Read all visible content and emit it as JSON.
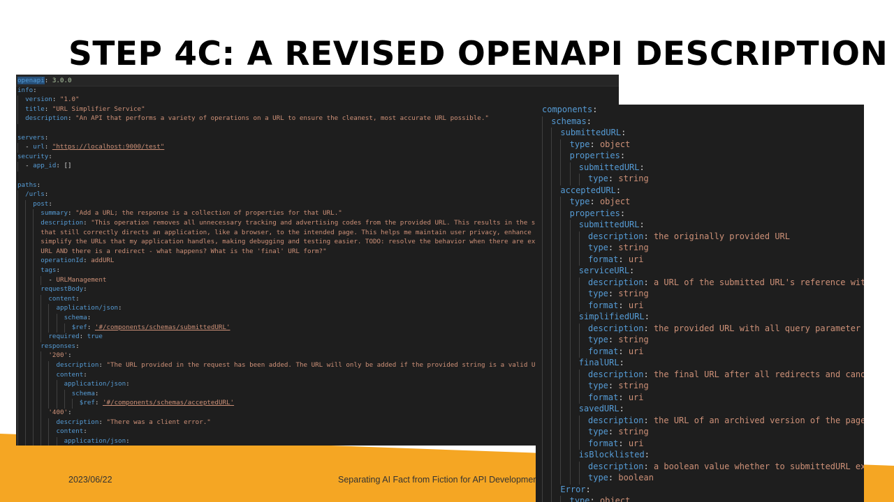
{
  "slide": {
    "title": "STEP 4C: A REVISED OPENAPI DESCRIPTION",
    "date": "2023/06/22",
    "subtitle": "Separating AI Fact from Fiction for API Development"
  },
  "colors": {
    "accent_orange": "#f5a623",
    "editor_background": "#1e1e1e",
    "key_blue": "#569cd6",
    "string_orange": "#ce9178",
    "value_green": "#b5cea8",
    "punctuation": "#d4d4d4"
  },
  "left_code": [
    {
      "indent": 0,
      "key": "openapi",
      "value": "3.0.0",
      "vtype": "c",
      "highlight_key": true
    },
    {
      "indent": 0,
      "key": "info"
    },
    {
      "indent": 2,
      "key": "version",
      "value": "\"1.0\"",
      "vtype": "s"
    },
    {
      "indent": 2,
      "key": "title",
      "value": "\"URL Simplifier Service\"",
      "vtype": "s"
    },
    {
      "indent": 2,
      "key": "description",
      "value": "\"An API that performs a variety of operations on a URL to ensure the cleanest, most accurate URL possible.\"",
      "vtype": "s"
    },
    {
      "indent": 0
    },
    {
      "indent": 0,
      "key": "servers"
    },
    {
      "indent": 2,
      "dash": true,
      "key": "url",
      "value": "\"https://localhost:9000/test\"",
      "vtype": "s",
      "underline": true
    },
    {
      "indent": 0,
      "key": "security"
    },
    {
      "indent": 2,
      "dash": true,
      "key": "app_id",
      "value": "[]",
      "vtype": "p"
    },
    {
      "indent": 0
    },
    {
      "indent": 0,
      "key": "paths"
    },
    {
      "indent": 2,
      "key": "/urls"
    },
    {
      "indent": 4,
      "key": "post"
    },
    {
      "indent": 6,
      "key": "summary",
      "value": "\"Add a URL; the response is a collection of properties for that URL.\"",
      "vtype": "s"
    },
    {
      "indent": 6,
      "key": "description",
      "value": "\"This operation removes all unnecessary tracking and advertising codes from the provided URL. This results in the simplest URL",
      "vtype": "s"
    },
    {
      "indent": 6,
      "text": "that still correctly directs an application, like a browser, to the intended page. This helps me maintain user privacy, enhance performance and",
      "vtype": "s"
    },
    {
      "indent": 6,
      "text": "simplify the URLs that my application handles, making debugging and testing easier. TODO: resolve the behavior when there are extra parameters in the",
      "vtype": "s"
    },
    {
      "indent": 6,
      "text": "URL AND there is a redirect - what happens? What is the 'final' URL form?\"",
      "vtype": "s"
    },
    {
      "indent": 6,
      "key": "operationId",
      "value": "addURL",
      "vtype": "s"
    },
    {
      "indent": 6,
      "key": "tags"
    },
    {
      "indent": 8,
      "dash": true,
      "text": "URLManagement",
      "vtype": "s"
    },
    {
      "indent": 6,
      "key": "requestBody"
    },
    {
      "indent": 8,
      "key": "content"
    },
    {
      "indent": 10,
      "key": "application/json"
    },
    {
      "indent": 12,
      "key": "schema"
    },
    {
      "indent": 14,
      "key": "$ref",
      "value": "'#/components/schemas/submittedURL'",
      "vtype": "s",
      "underline": true
    },
    {
      "indent": 8,
      "key": "required",
      "value": "true",
      "vtype": "k"
    },
    {
      "indent": 6,
      "key": "responses"
    },
    {
      "indent": 8,
      "key": "'200'",
      "keytype": "s"
    },
    {
      "indent": 10,
      "key": "description",
      "value": "\"The URL provided in the request has been added. The URL will only be added if the provided string is a valid URL.\"",
      "vtype": "s"
    },
    {
      "indent": 10,
      "key": "content"
    },
    {
      "indent": 12,
      "key": "application/json"
    },
    {
      "indent": 14,
      "key": "schema"
    },
    {
      "indent": 16,
      "key": "$ref",
      "value": "'#/components/schemas/acceptedURL'",
      "vtype": "s",
      "underline": true
    },
    {
      "indent": 8,
      "key": "'400'",
      "keytype": "s"
    },
    {
      "indent": 10,
      "key": "description",
      "value": "\"There was a client error.\"",
      "vtype": "s"
    },
    {
      "indent": 10,
      "key": "content"
    },
    {
      "indent": 12,
      "key": "application/json"
    }
  ],
  "right_code": [
    {
      "indent": 0,
      "key": "components"
    },
    {
      "indent": 2,
      "key": "schemas"
    },
    {
      "indent": 4,
      "key": "submittedURL"
    },
    {
      "indent": 6,
      "key": "type",
      "value": "object",
      "vtype": "s"
    },
    {
      "indent": 6,
      "key": "properties"
    },
    {
      "indent": 8,
      "key": "submittedURL"
    },
    {
      "indent": 10,
      "key": "type",
      "value": "string",
      "vtype": "s"
    },
    {
      "indent": 4,
      "key": "acceptedURL"
    },
    {
      "indent": 6,
      "key": "type",
      "value": "object",
      "vtype": "s"
    },
    {
      "indent": 6,
      "key": "properties"
    },
    {
      "indent": 8,
      "key": "submittedURL"
    },
    {
      "indent": 10,
      "key": "description",
      "value": "the originally provided URL",
      "vtype": "s"
    },
    {
      "indent": 10,
      "key": "type",
      "value": "string",
      "vtype": "s"
    },
    {
      "indent": 10,
      "key": "format",
      "value": "uri",
      "vtype": "s"
    },
    {
      "indent": 8,
      "key": "serviceURL"
    },
    {
      "indent": 10,
      "key": "description",
      "value": "a URL of the submitted URL's reference within the service",
      "vtype": "s"
    },
    {
      "indent": 10,
      "key": "type",
      "value": "string",
      "vtype": "s"
    },
    {
      "indent": 10,
      "key": "format",
      "value": "uri",
      "vtype": "s"
    },
    {
      "indent": 8,
      "key": "simplifiedURL"
    },
    {
      "indent": 10,
      "key": "description",
      "value": "the provided URL with all query parameter ad tracking removed",
      "vtype": "s"
    },
    {
      "indent": 10,
      "key": "type",
      "value": "string",
      "vtype": "s"
    },
    {
      "indent": 10,
      "key": "format",
      "value": "uri",
      "vtype": "s"
    },
    {
      "indent": 8,
      "key": "finalURL"
    },
    {
      "indent": 10,
      "key": "description",
      "value": "the final URL after all redirects and canonicalization",
      "vtype": "s"
    },
    {
      "indent": 10,
      "key": "type",
      "value": "string",
      "vtype": "s"
    },
    {
      "indent": 10,
      "key": "format",
      "value": "uri",
      "vtype": "s"
    },
    {
      "indent": 8,
      "key": "savedURL"
    },
    {
      "indent": 10,
      "key": "description",
      "value": "the URL of an archived version of the page; if available",
      "vtype": "s"
    },
    {
      "indent": 10,
      "key": "type",
      "value": "string",
      "vtype": "s"
    },
    {
      "indent": 10,
      "key": "format",
      "value": "uri",
      "vtype": "s"
    },
    {
      "indent": 8,
      "key": "isBlocklisted"
    },
    {
      "indent": 10,
      "key": "description",
      "value": "a boolean value whether to submittedURL exists in a blocklist",
      "vtype": "s"
    },
    {
      "indent": 10,
      "key": "type",
      "value": "boolean",
      "vtype": "s"
    },
    {
      "indent": 4,
      "key": "Error"
    },
    {
      "indent": 6,
      "key": "type",
      "value": "object",
      "vtype": "s"
    }
  ]
}
